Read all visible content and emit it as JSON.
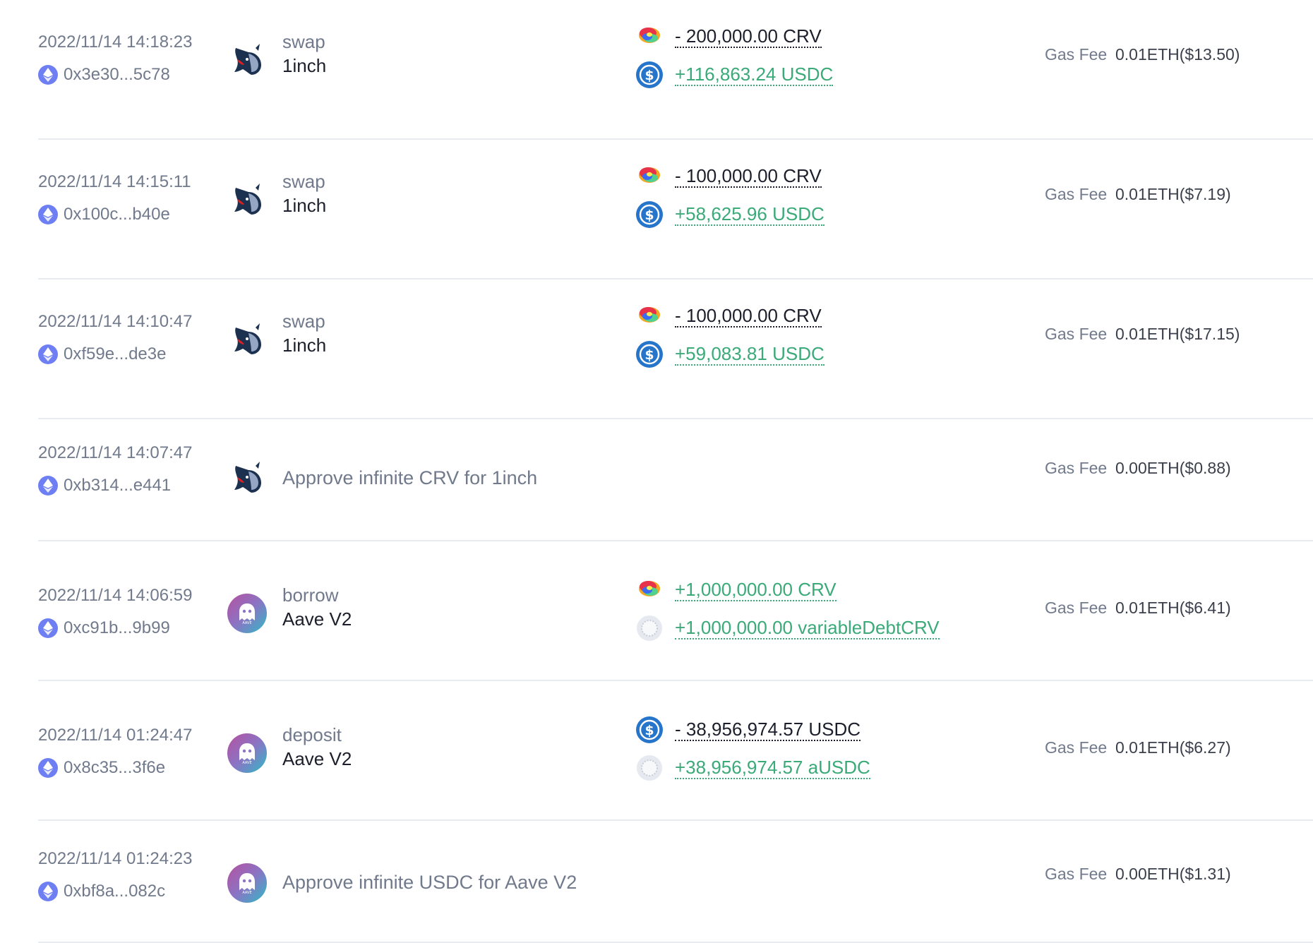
{
  "colors": {
    "positive": "#3aaa78",
    "negative": "#1c1f2b",
    "muted": "#717a8c",
    "divider": "#e8ebf0",
    "eth": "#6e7ff3",
    "usdc": "#2775ca"
  },
  "gas_label": "Gas Fee",
  "transactions": [
    {
      "time": "2022/11/14 14:18:23",
      "hash": "0x3e30...5c78",
      "protocol_icon": "unicorn-1inch-icon",
      "action": "swap",
      "protocol": "1inch",
      "tokens": [
        {
          "icon": "crv-icon",
          "amount": "- 200,000.00 CRV",
          "direction": "out"
        },
        {
          "icon": "usdc-icon",
          "amount": "+116,863.24 USDC",
          "direction": "in"
        }
      ],
      "gas_fee": "0.01ETH($13.50)"
    },
    {
      "time": "2022/11/14 14:15:11",
      "hash": "0x100c...b40e",
      "protocol_icon": "unicorn-1inch-icon",
      "action": "swap",
      "protocol": "1inch",
      "tokens": [
        {
          "icon": "crv-icon",
          "amount": "- 100,000.00 CRV",
          "direction": "out"
        },
        {
          "icon": "usdc-icon",
          "amount": "+58,625.96 USDC",
          "direction": "in"
        }
      ],
      "gas_fee": "0.01ETH($7.19)"
    },
    {
      "time": "2022/11/14 14:10:47",
      "hash": "0xf59e...de3e",
      "protocol_icon": "unicorn-1inch-icon",
      "action": "swap",
      "protocol": "1inch",
      "tokens": [
        {
          "icon": "crv-icon",
          "amount": "- 100,000.00 CRV",
          "direction": "out"
        },
        {
          "icon": "usdc-icon",
          "amount": "+59,083.81 USDC",
          "direction": "in"
        }
      ],
      "gas_fee": "0.01ETH($17.15)"
    },
    {
      "time": "2022/11/14 14:07:47",
      "hash": "0xb314...e441",
      "protocol_icon": "unicorn-1inch-icon",
      "approve": "Approve infinite CRV for 1inch",
      "gas_fee": "0.00ETH($0.88)"
    },
    {
      "time": "2022/11/14 14:06:59",
      "hash": "0xc91b...9b99",
      "protocol_icon": "aave-ghost-icon",
      "action": "borrow",
      "protocol": "Aave V2",
      "tokens": [
        {
          "icon": "crv-icon",
          "amount": "+1,000,000.00 CRV",
          "direction": "in"
        },
        {
          "icon": "generic-token-icon",
          "amount": "+1,000,000.00 variableDebtCRV",
          "direction": "in"
        }
      ],
      "gas_fee": "0.01ETH($6.41)"
    },
    {
      "time": "2022/11/14 01:24:47",
      "hash": "0x8c35...3f6e",
      "protocol_icon": "aave-ghost-icon",
      "action": "deposit",
      "protocol": "Aave V2",
      "tokens": [
        {
          "icon": "usdc-icon",
          "amount": "- 38,956,974.57 USDC",
          "direction": "out"
        },
        {
          "icon": "generic-token-icon",
          "amount": "+38,956,974.57 aUSDC",
          "direction": "in"
        }
      ],
      "gas_fee": "0.01ETH($6.27)"
    },
    {
      "time": "2022/11/14 01:24:23",
      "hash": "0xbf8a...082c",
      "protocol_icon": "aave-ghost-icon",
      "approve": "Approve infinite USDC for Aave V2",
      "gas_fee": "0.00ETH($1.31)"
    }
  ]
}
